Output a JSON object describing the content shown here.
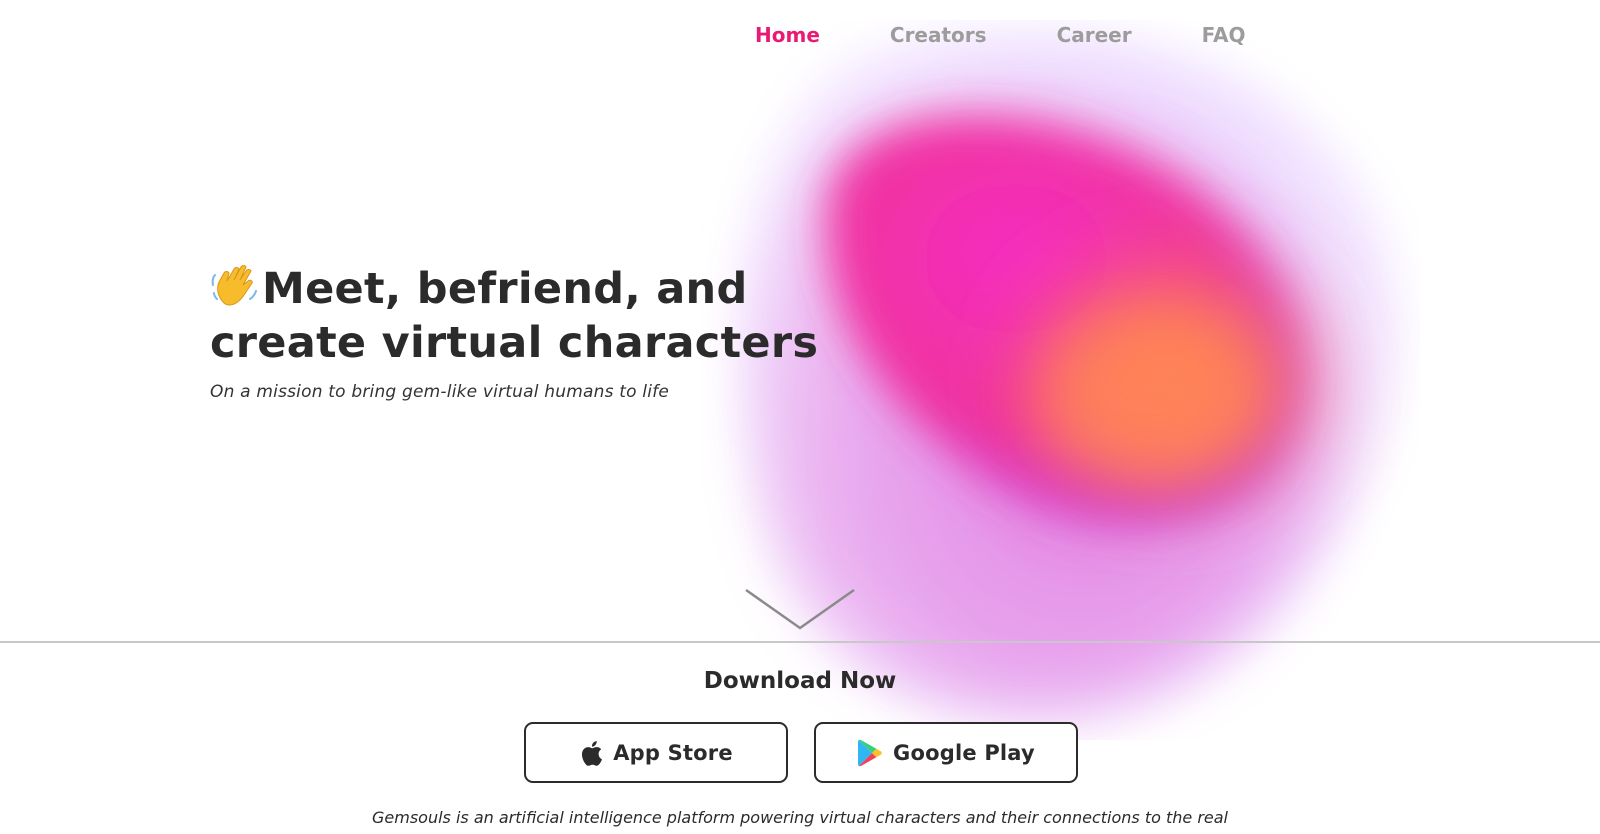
{
  "nav": {
    "items": [
      {
        "label": "Home",
        "active": true
      },
      {
        "label": "Creators",
        "active": false
      },
      {
        "label": "Career",
        "active": false
      },
      {
        "label": "FAQ",
        "active": false
      }
    ]
  },
  "hero": {
    "title_line1": "Meet, befriend, and",
    "title_line2": "create virtual characters",
    "subtitle": "On a mission to bring gem-like virtual humans to life",
    "icon": "waving-hand-icon"
  },
  "download": {
    "title": "Download Now",
    "app_store_label": "App Store",
    "google_play_label": "Google Play"
  },
  "description": "Gemsouls is an artificial intelligence platform powering virtual characters and their connections to the real world.",
  "colors": {
    "accent": "#e81b74",
    "nav_inactive": "#9c9c9c",
    "text": "#2b2b2b",
    "divider": "#c8c8c8"
  }
}
